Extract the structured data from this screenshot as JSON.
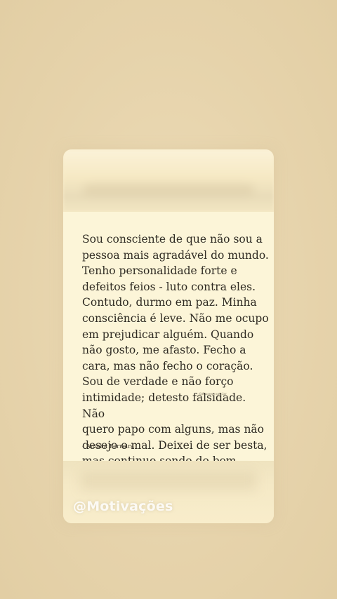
{
  "quote": {
    "text": "Sou consciente de que não sou a\npessoa mais agradável do mundo.\nTenho personalidade forte e\ndefeitos feios - luto contra eles.\nContudo, durmo em paz. Minha\nconsciência é leve. Não me ocupo\nem prejudicar alguém. Quando\nnão gosto, me afasto. Fecho a\ncara, mas não fecho o coração.\nSou de verdade e não forço\nintimidade; detesto falsidade. Não\nquero papo com alguns, mas não\ndesejo o mal. Deixei de ser besta,\nmas continuo sendo do bem.",
    "author": "- Aninha Ferreira",
    "small_watermark": "@frases.com.br"
  },
  "overlay": {
    "handle": "@Motivações"
  },
  "colors": {
    "background": "#e8d6af",
    "card": "#fcf5d8",
    "text": "#2e2a22"
  }
}
